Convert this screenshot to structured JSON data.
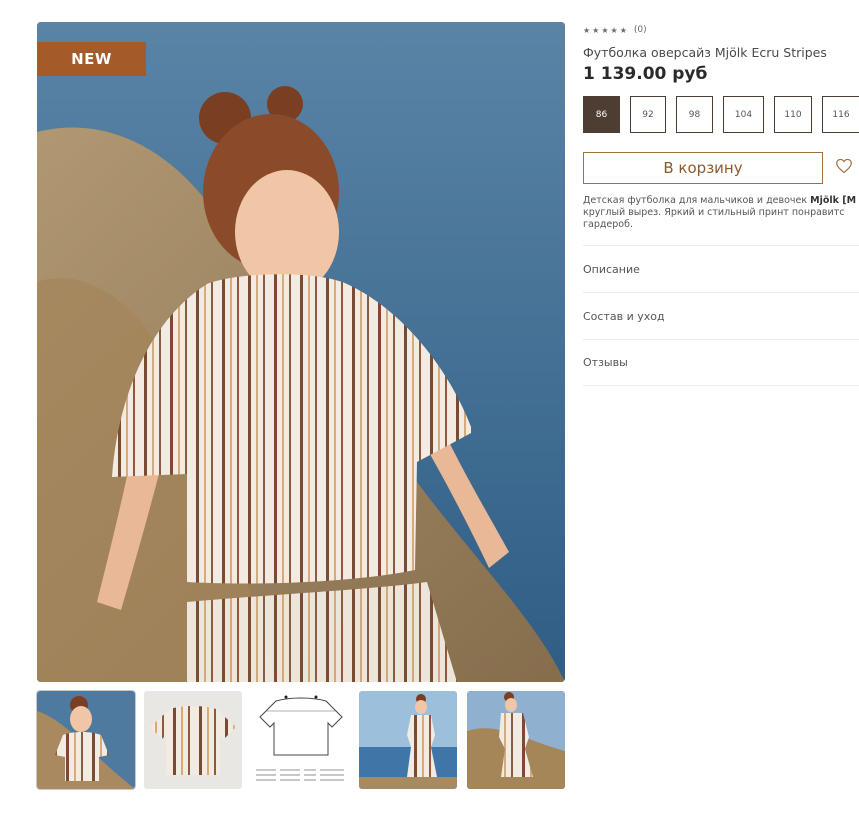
{
  "product": {
    "badge": "NEW",
    "rating_stars": "★★★★★",
    "review_count": "(0)",
    "title": "Футболка оверсайз Mjölk Ecru Stripes",
    "price": "1 139.00 руб",
    "add_to_cart_label": "В корзину",
    "description_line1_prefix": "Детская футболка для мальчиков и девочек ",
    "description_line1_bold": "Mjölk [M",
    "description_line2": "круглый вырез. Яркий и стильный принт понравитс",
    "description_line3": "гардероб."
  },
  "sizes": [
    "86",
    "92",
    "98",
    "104",
    "110",
    "116"
  ],
  "selected_size": "86",
  "accordion": {
    "description": "Описание",
    "composition": "Состав и уход",
    "reviews": "Отзывы"
  },
  "colors": {
    "accent": "#a55a2a",
    "size_selected": "#4d3d33",
    "cart_border": "#a0703e"
  }
}
